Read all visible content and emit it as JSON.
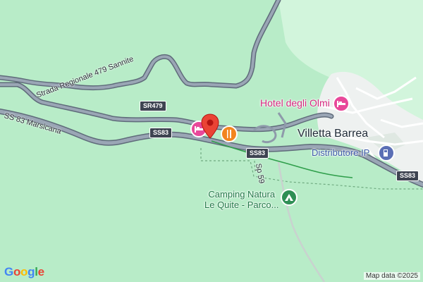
{
  "map": {
    "background": "#b8ecc8",
    "urban_color": "#f1f3f4",
    "road_fill": "#8e9aaa",
    "road_outline": "#5f6b7a"
  },
  "roads": {
    "regional": "Strada Regionale 479 Sannite",
    "state": "SS 83 Marsicana",
    "provincial": "Sp 59",
    "shields": {
      "sr479": "SR479",
      "ss83_a": "SS83",
      "ss83_b": "SS83",
      "ss83_c": "SS83"
    }
  },
  "places": {
    "town": "Villetta Barrea",
    "hotel": "Hotel degli Olmi",
    "fuel": "Distributore IP",
    "camping_line1": "Camping Natura",
    "camping_line2": "Le Quite - Parco..."
  },
  "icons": {
    "hotel": "bed-icon",
    "restaurant": "fork-knife-icon",
    "fuel": "fuel-pump-icon",
    "camping": "tent-icon",
    "pin": "map-pin-icon"
  },
  "footer": {
    "attribution": "Map data ©2025",
    "logo_letters": [
      "G",
      "o",
      "o",
      "g",
      "l",
      "e"
    ]
  }
}
